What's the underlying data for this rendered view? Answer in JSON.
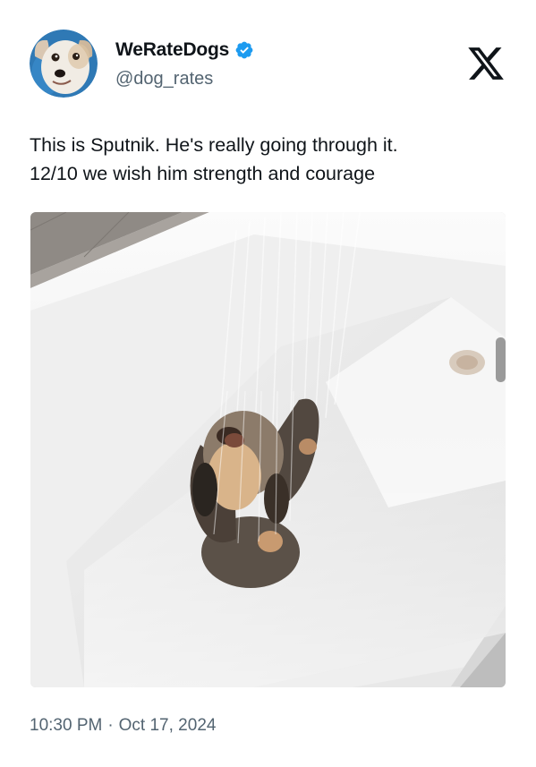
{
  "tweet": {
    "author": {
      "display_name": "WeRateDogs",
      "handle": "@dog_rates",
      "verified": true,
      "verified_color": "#1d9bf0"
    },
    "platform_logo": "x-logo-icon",
    "text_lines": [
      "This is Sputnik. He's really going through it.",
      "12/10 we wish him strength and courage"
    ],
    "media": {
      "type": "photo",
      "alt_icon": "dog-in-bathtub-photo"
    },
    "time": "10:30 PM",
    "separator": "·",
    "date": "Oct 17, 2024"
  },
  "colors": {
    "text_primary": "#0f1419",
    "text_secondary": "#536471",
    "accent": "#1d9bf0"
  }
}
